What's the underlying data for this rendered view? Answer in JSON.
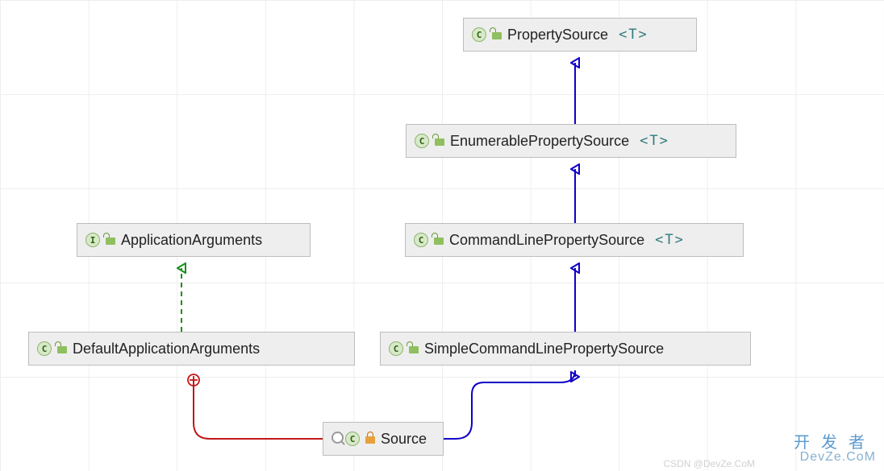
{
  "nodes": {
    "propertySource": {
      "kind": "class",
      "name": "PropertySource",
      "typeParam": "<T>"
    },
    "enumerablePropertySource": {
      "kind": "class",
      "name": "EnumerablePropertySource",
      "typeParam": "<T>"
    },
    "commandLinePropertySource": {
      "kind": "class",
      "name": "CommandLinePropertySource",
      "typeParam": "<T>"
    },
    "simpleCmdLinePropSource": {
      "kind": "class",
      "name": "SimpleCommandLinePropertySource",
      "typeParam": ""
    },
    "applicationArguments": {
      "kind": "interface",
      "name": "ApplicationArguments",
      "typeParam": ""
    },
    "defaultAppArguments": {
      "kind": "class",
      "name": "DefaultApplicationArguments",
      "typeParam": ""
    },
    "source": {
      "kind": "inner",
      "name": "Source",
      "typeParam": ""
    }
  },
  "edges": [
    {
      "from": "enumerablePropertySource",
      "to": "propertySource",
      "style": "extends"
    },
    {
      "from": "commandLinePropertySource",
      "to": "enumerablePropertySource",
      "style": "extends"
    },
    {
      "from": "simpleCmdLinePropSource",
      "to": "commandLinePropertySource",
      "style": "extends"
    },
    {
      "from": "source",
      "to": "simpleCmdLinePropSource",
      "style": "extends"
    },
    {
      "from": "defaultAppArguments",
      "to": "applicationArguments",
      "style": "implements"
    },
    {
      "from": "source",
      "to": "defaultAppArguments",
      "style": "inner"
    }
  ],
  "legend": {
    "extends": {
      "color": "#1100c8",
      "dash": "none",
      "head": "triangle"
    },
    "implements": {
      "color": "#1a8f1a",
      "dash": "6 5",
      "head": "triangle"
    },
    "inner": {
      "color": "#c01818",
      "dash": "none",
      "head": "circle-plus"
    }
  },
  "watermark": {
    "cn": "开发者",
    "en": "DevZe.CoM",
    "credit": "CSDN @DevZe.CoM"
  }
}
